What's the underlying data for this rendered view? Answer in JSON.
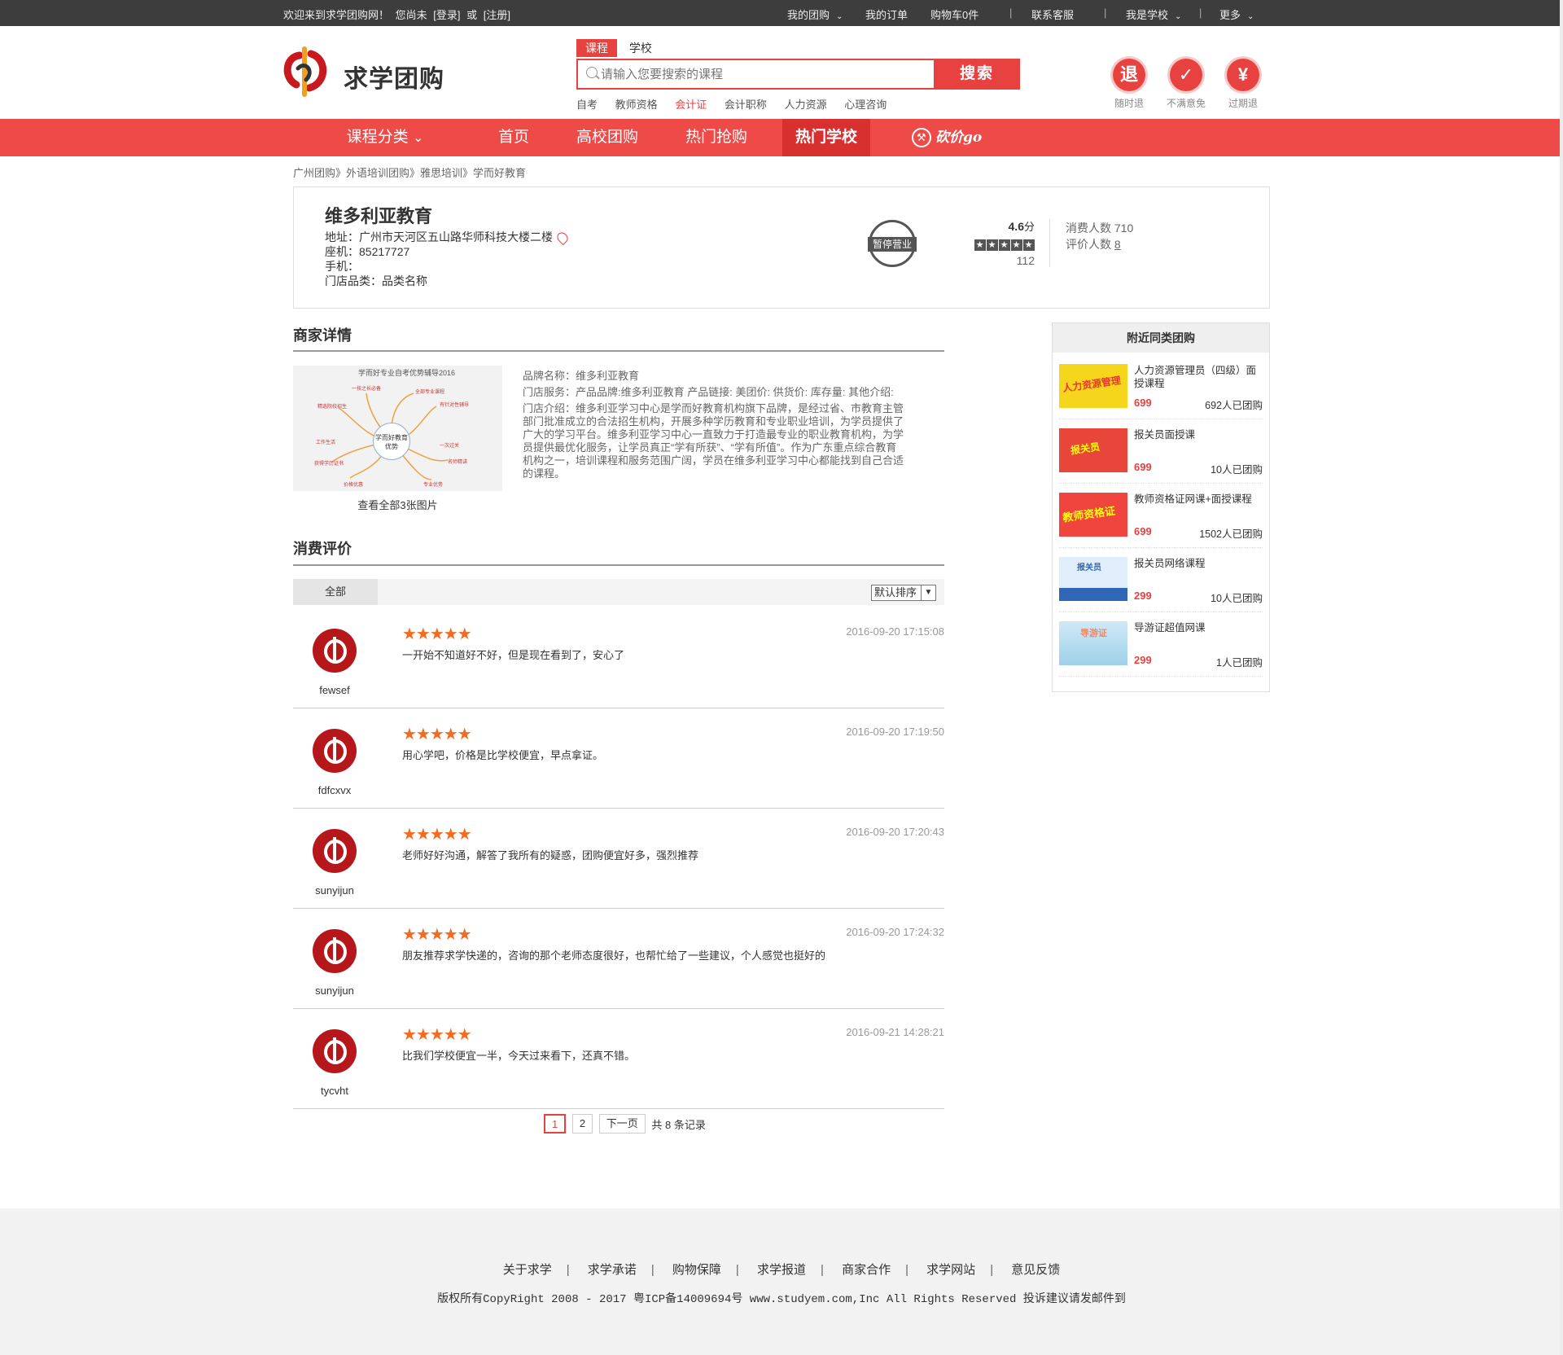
{
  "topbar": {
    "welcome": "欢迎来到求学团购网！",
    "not_logged": "您尚未",
    "login": "[登录]",
    "or": "或",
    "register": "[注册]",
    "my_group": "我的团购",
    "my_orders": "我的订单",
    "cart": "购物车0件",
    "contact": "联系客服",
    "i_am_school": "我是学校",
    "more": "更多"
  },
  "header": {
    "logo_text": "求学团购",
    "search_tabs": [
      "课程",
      "学校"
    ],
    "search_placeholder": "请输入您要搜索的课程",
    "search_button": "搜索",
    "hot_keywords": [
      "自考",
      "教师资格",
      "会计证",
      "会计职称",
      "人力资源",
      "心理咨询"
    ],
    "guarantees": [
      {
        "glyph": "退",
        "label": "随时退"
      },
      {
        "glyph": "✓",
        "label": "不满意免"
      },
      {
        "glyph": "¥",
        "label": "过期退"
      }
    ]
  },
  "nav": {
    "category": "课程分类",
    "items": [
      "首页",
      "高校团购",
      "热门抢购",
      "热门学校"
    ],
    "kanjia": "砍价go"
  },
  "breadcrumb": "广州团购》外语培训团购》雅思培训》学而好教育",
  "shop": {
    "name": "维多利亚教育",
    "address": "地址：广州市天河区五山路华师科技大楼二楼",
    "landline": "座机：85217727",
    "mobile": "手机：",
    "category": "门店品类：品类名称",
    "status": "暂停营业",
    "score": "4.6",
    "score_unit": "分",
    "rating": 4.6,
    "score_count": "112",
    "consumers_label": "消费人数",
    "consumers": "710",
    "reviewers_label": "评价人数",
    "reviewers": "8"
  },
  "detail": {
    "title": "商家详情",
    "img_title": "学而好专业自考优势辅导2016",
    "img_center": "学而好教育优势",
    "img_caption": "查看全部3张图片",
    "brand": "品牌名称：维多利亚教育",
    "service": "门店服务：产品品牌:维多利亚教育 产品链接: 美团价: 供货价: 库存量: 其他介绍:",
    "intro": "门店介绍：维多利亚学习中心是学而好教育机构旗下品牌，是经过省、市教育主管部门批准成立的合法招生机构，开展多种学历教育和专业职业培训，为学员提供了广大的学习平台。维多利亚学习中心一直致力于打造最专业的职业教育机构，为学员提供最优化服务，让学员真正“学有所获”、“学有所值”。作为广东重点综合教育机构之一，培训课程和服务范围广阔，学员在维多利亚学习中心都能找到自己合适的课程。"
  },
  "reviews": {
    "title": "消费评价",
    "filter_all": "全部",
    "sort": "默认排序",
    "items": [
      {
        "user": "fewsef",
        "time": "2016-09-20 17:15:08",
        "text": "一开始不知道好不好，但是现在看到了，安心了",
        "stars": "★★★★★"
      },
      {
        "user": "fdfcxvx",
        "time": "2016-09-20 17:19:50",
        "text": "用心学吧，价格是比学校便宜，早点拿证。",
        "stars": "★★★★★"
      },
      {
        "user": "sunyijun",
        "time": "2016-09-20 17:20:43",
        "text": "老师好好沟通，解答了我所有的疑惑，团购便宜好多，强烈推荐",
        "stars": "★★★★★"
      },
      {
        "user": "sunyijun",
        "time": "2016-09-20 17:24:32",
        "text": "朋友推荐求学快递的，咨询的那个老师态度很好，也帮忙给了一些建议，个人感觉也挺好的",
        "stars": "★★★★★"
      },
      {
        "user": "tycvht",
        "time": "2016-09-21 14:28:21",
        "text": "比我们学校便宜一半，今天过来看下，还真不错。",
        "stars": "★★★★★"
      }
    ]
  },
  "pager": {
    "pages": [
      "1",
      "2"
    ],
    "next": "下一页",
    "total": "共 8 条记录"
  },
  "sidebar": {
    "title": "附近同类团购",
    "items": [
      {
        "title": "人力资源管理员（四级）面授课程",
        "price": "699",
        "bought": "692人已团购",
        "thumb_text": "人力资源管理",
        "color": "#f5d61c"
      },
      {
        "title": "报关员面授课",
        "price": "699",
        "bought": "10人已团购",
        "thumb_text": "报关员",
        "color": "#e9463b"
      },
      {
        "title": "教师资格证网课+面授课程",
        "price": "699",
        "bought": "1502人已团购",
        "thumb_text": "教师资格证",
        "color": "#f0453e"
      },
      {
        "title": "报关员网络课程",
        "price": "299",
        "bought": "10人已团购",
        "thumb_text": "报关员",
        "color": "#2f66b8"
      },
      {
        "title": "导游证超值网课",
        "price": "299",
        "bought": "1人已团购",
        "thumb_text": "导游证",
        "color": "#8fc8e8"
      }
    ]
  },
  "footer": {
    "links": [
      "关于求学",
      "求学承诺",
      "购物保障",
      "求学报道",
      "商家合作",
      "求学网站",
      "意见反馈"
    ],
    "copyright": "版权所有CopyRight 2008 - 2017 粤ICP备14009694号 www.studyem.com,Inc All Rights Reserved 投诉建议请发邮件到"
  },
  "colors": {
    "brand_red": "#e84240",
    "nav_red": "#ed4a48",
    "topbar": "#3d3d3d",
    "star_orange": "#f46a1e"
  }
}
